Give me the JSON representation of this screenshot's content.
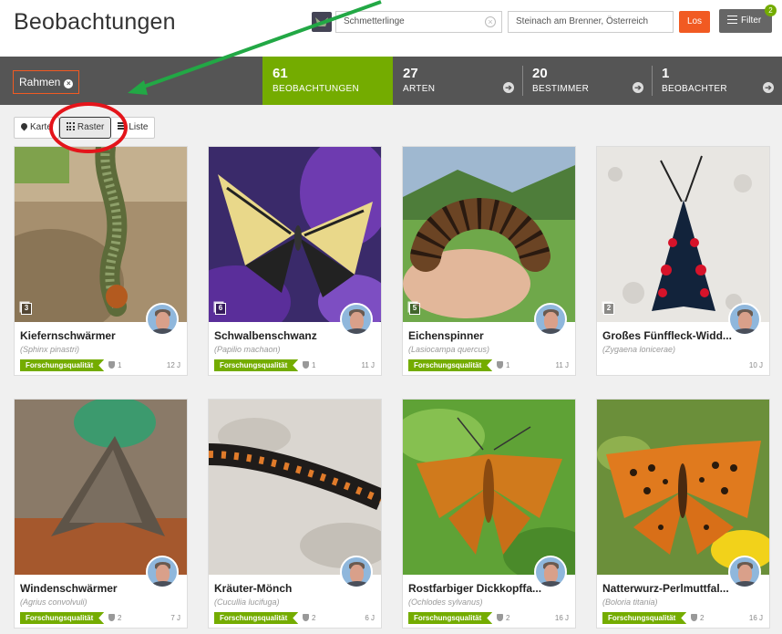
{
  "header": {
    "title": "Beobachtungen",
    "taxon_search": "Schmetterlinge",
    "place_search": "Steinach am Brenner, Österreich",
    "go_label": "Los",
    "filter_label": "Filter",
    "filter_count": "2"
  },
  "statsbar": {
    "frame_chip": "Rahmen",
    "stats": [
      {
        "num": "61",
        "label": "BEOBACHTUNGEN"
      },
      {
        "num": "27",
        "label": "ARTEN"
      },
      {
        "num": "20",
        "label": "BESTIMMER"
      },
      {
        "num": "1",
        "label": "BEOBACHTER"
      }
    ]
  },
  "view_toggle": {
    "map": "Karte",
    "grid": "Raster",
    "list": "Liste"
  },
  "colors": {
    "accent_green": "#74ac00",
    "accent_orange": "#f15a22",
    "annotation_red": "#e4141a",
    "annotation_green": "#22a845"
  },
  "cards": [
    {
      "name": "Kiefernschwärmer",
      "sci": "(Sphinx pinastri)",
      "photos": "3",
      "quality": "Forschungsqualität",
      "ids": "1",
      "age": "12 J"
    },
    {
      "name": "Schwalbenschwanz",
      "sci": "(Papilio machaon)",
      "photos": "6",
      "quality": "Forschungsqualität",
      "ids": "1",
      "age": "11 J"
    },
    {
      "name": "Eichenspinner",
      "sci": "(Lasiocampa quercus)",
      "photos": "5",
      "quality": "Forschungsqualität",
      "ids": "1",
      "age": "11 J"
    },
    {
      "name": "Großes Fünffleck-Widd...",
      "sci": "(Zygaena lonicerae)",
      "photos": "2",
      "quality": "",
      "ids": "",
      "age": "10 J"
    },
    {
      "name": "Windenschwärmer",
      "sci": "(Agrius convolvuli)",
      "photos": "",
      "quality": "Forschungsqualität",
      "ids": "2",
      "age": "7 J"
    },
    {
      "name": "Kräuter-Mönch",
      "sci": "(Cucullia lucifuga)",
      "photos": "",
      "quality": "Forschungsqualität",
      "ids": "2",
      "age": "6 J"
    },
    {
      "name": "Rostfarbiger Dickkopffa...",
      "sci": "(Ochlodes sylvanus)",
      "photos": "",
      "quality": "Forschungsqualität",
      "ids": "2",
      "age": "16 J"
    },
    {
      "name": "Natterwurz-Perlmuttfal...",
      "sci": "(Boloria titania)",
      "photos": "",
      "quality": "Forschungsqualität",
      "ids": "2",
      "age": "16 J"
    }
  ]
}
